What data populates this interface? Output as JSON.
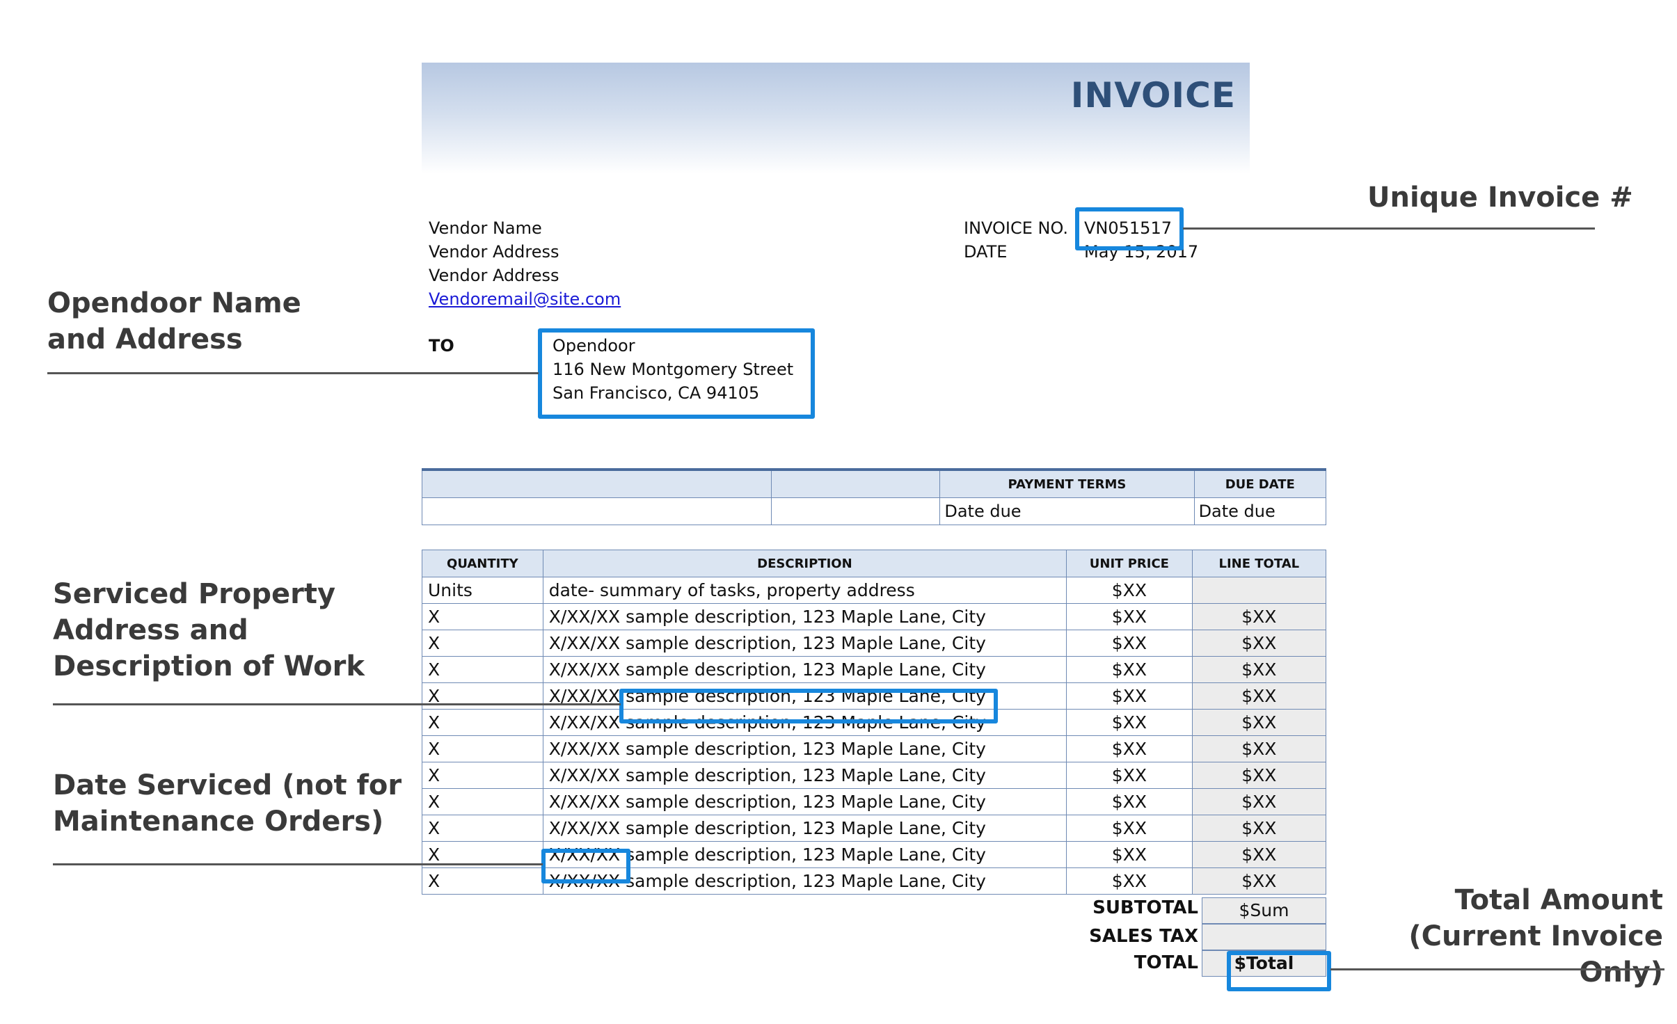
{
  "invoice": {
    "title": "INVOICE",
    "vendor": {
      "name": "Vendor Name",
      "address_line1": "Vendor Address",
      "address_line2": "Vendor Address",
      "email": "Vendoremail@site.com"
    },
    "invoice_no_label": "INVOICE NO.",
    "invoice_no": "VN051517",
    "date_label": "DATE",
    "date": "May 15, 2017",
    "to_label": "TO",
    "to": {
      "name": "Opendoor",
      "street": "116 New Montgomery Street",
      "city": "San Francisco, CA 94105"
    },
    "terms_table": {
      "headers": [
        "",
        "",
        "PAYMENT TERMS",
        "DUE DATE"
      ],
      "row": [
        "",
        "",
        "Date due",
        "Date due"
      ]
    },
    "items_table": {
      "headers": [
        "QUANTITY",
        "DESCRIPTION",
        "UNIT PRICE",
        "LINE TOTAL"
      ],
      "rows": [
        [
          "Units",
          "date- summary of tasks, property address",
          "$XX",
          ""
        ],
        [
          "X",
          "X/XX/XX sample description, 123 Maple Lane, City",
          "$XX",
          "$XX"
        ],
        [
          "X",
          "X/XX/XX sample description, 123 Maple Lane, City",
          "$XX",
          "$XX"
        ],
        [
          "X",
          "X/XX/XX sample description, 123 Maple Lane, City",
          "$XX",
          "$XX"
        ],
        [
          "X",
          "X/XX/XX sample description, 123 Maple Lane, City",
          "$XX",
          "$XX"
        ],
        [
          "X",
          "X/XX/XX sample description, 123 Maple Lane, City",
          "$XX",
          "$XX"
        ],
        [
          "X",
          "X/XX/XX sample description, 123 Maple Lane, City",
          "$XX",
          "$XX"
        ],
        [
          "X",
          "X/XX/XX sample description, 123 Maple Lane, City",
          "$XX",
          "$XX"
        ],
        [
          "X",
          "X/XX/XX sample description, 123 Maple Lane, City",
          "$XX",
          "$XX"
        ],
        [
          "X",
          "X/XX/XX sample description, 123 Maple Lane, City",
          "$XX",
          "$XX"
        ],
        [
          "X",
          "X/XX/XX sample description, 123 Maple Lane, City",
          "$XX",
          "$XX"
        ],
        [
          "X",
          "X/XX/XX sample description, 123 Maple Lane, City",
          "$XX",
          "$XX"
        ]
      ]
    },
    "totals": {
      "subtotal_label": "SUBTOTAL",
      "subtotal": "$Sum",
      "sales_tax_label": "SALES TAX",
      "sales_tax": "",
      "total_label": "TOTAL",
      "total": "$Total"
    }
  },
  "callouts": {
    "opendoor_name_address": [
      "Opendoor Name",
      "and Address"
    ],
    "unique_invoice": "Unique Invoice #",
    "serviced_property": [
      "Serviced Property",
      "Address and",
      "Description of Work"
    ],
    "date_serviced": [
      "Date Serviced (not for",
      "Maintenance Orders)"
    ],
    "total_amount": [
      "Total Amount",
      "(Current Invoice Only)"
    ]
  },
  "colors": {
    "highlight_box": "#1787dd",
    "title": "#2e4f78",
    "header_fill": "#dbe5f2",
    "table_border": "#6f8ab4"
  }
}
